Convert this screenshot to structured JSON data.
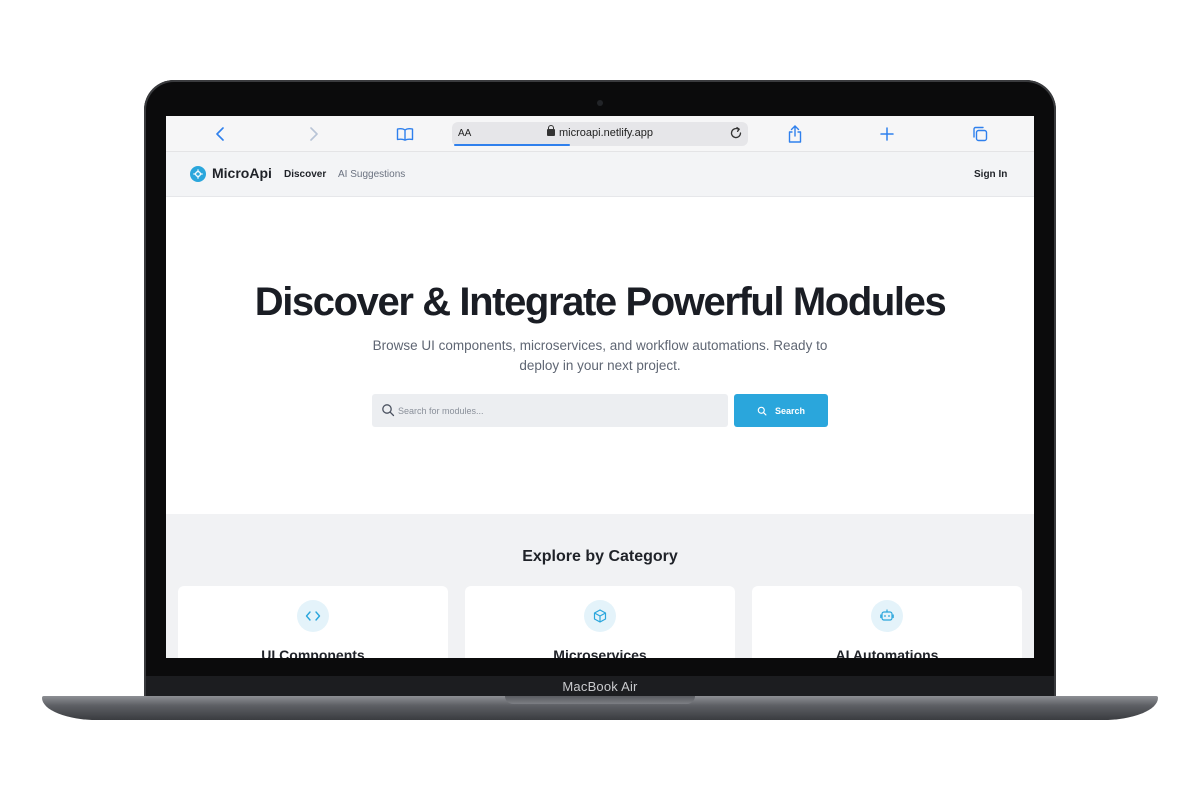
{
  "device": {
    "label": "MacBook Air"
  },
  "browser": {
    "url": "microapi.netlify.app",
    "text_size_label": "AA",
    "icons": [
      "chevron-left-icon",
      "chevron-right-icon",
      "book-icon",
      "lock-icon",
      "reload-icon",
      "share-icon",
      "plus-icon",
      "tabs-icon"
    ],
    "accent_color": "#2f80ed"
  },
  "nav": {
    "logo": "MicroApi",
    "links": [
      {
        "label": "Discover"
      },
      {
        "label": "AI Suggestions"
      }
    ],
    "sign_in": "Sign In"
  },
  "hero": {
    "title": "Discover & Integrate Powerful Modules",
    "subtitle": "Browse UI components, microservices, and workflow automations. Ready to deploy in your next project.",
    "search_placeholder": "Search for modules...",
    "search_button": "Search"
  },
  "categories": {
    "title": "Explore by Category",
    "items": [
      {
        "label": "UI Components",
        "icon": "code-icon"
      },
      {
        "label": "Microservices",
        "icon": "cube-icon"
      },
      {
        "label": "AI Automations",
        "icon": "bot-icon"
      }
    ]
  },
  "colors": {
    "brand": "#2aa6dc",
    "text_dark": "#1a1d24",
    "icon_bg": "#e4f3fa"
  }
}
